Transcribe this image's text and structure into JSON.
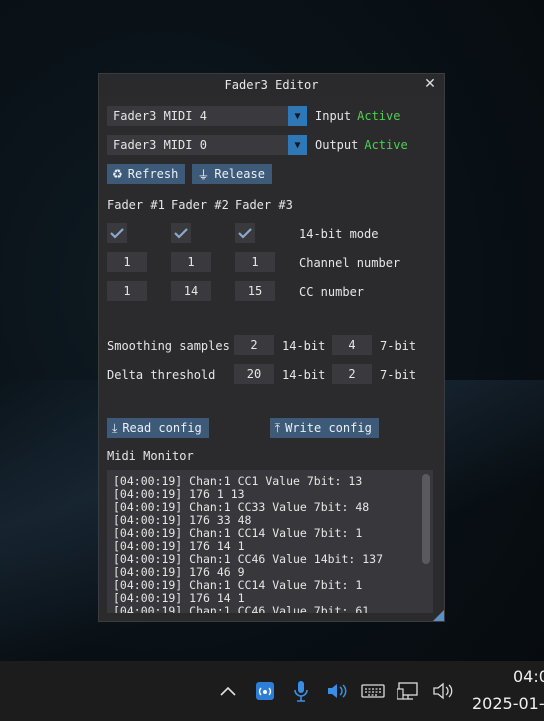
{
  "window": {
    "title": "Fader3 Editor"
  },
  "io": {
    "input": {
      "device": "Fader3 MIDI 4",
      "label": "Input",
      "status": "Active"
    },
    "output": {
      "device": "Fader3 MIDI 0",
      "label": "Output",
      "status": "Active"
    }
  },
  "buttons": {
    "refresh": "Refresh",
    "release": "Release",
    "read_config": "Read config",
    "write_config": "Write config"
  },
  "faders": {
    "headers": [
      "Fader #1",
      "Fader #2",
      "Fader #3"
    ],
    "mode_label": "14-bit mode",
    "channel_label": "Channel number",
    "cc_label": "CC number",
    "channels": [
      "1",
      "1",
      "1"
    ],
    "ccs": [
      "1",
      "14",
      "15"
    ]
  },
  "smoothing": {
    "label": "Smoothing samples",
    "v14": "2",
    "u14": "14-bit",
    "v7": "4",
    "u7": "7-bit"
  },
  "delta": {
    "label": "Delta threshold",
    "v14": "20",
    "u14": "14-bit",
    "v7": "2",
    "u7": "7-bit"
  },
  "monitor": {
    "title": "Midi Monitor",
    "lines": [
      "[04:00:19] Chan:1 CC1 Value 7bit: 13",
      "[04:00:19] 176 1 13",
      "[04:00:19] Chan:1 CC33 Value 7bit: 48",
      "[04:00:19] 176 33 48",
      "[04:00:19] Chan:1 CC14 Value 7bit: 1",
      "[04:00:19] 176 14 1",
      "[04:00:19] Chan:1 CC46 Value 14bit: 137",
      "[04:00:19] 176 46 9",
      "[04:00:19] Chan:1 CC14 Value 7bit: 1",
      "[04:00:19] 176 14 1",
      "[04:00:19] Chan:1 CC46 Value 7bit: 61"
    ]
  },
  "taskbar": {
    "time": "04:0",
    "date": "2025-01-"
  },
  "colors": {
    "accent": "#2f78b8",
    "active": "#4cd04c",
    "button": "#3d5a78"
  }
}
